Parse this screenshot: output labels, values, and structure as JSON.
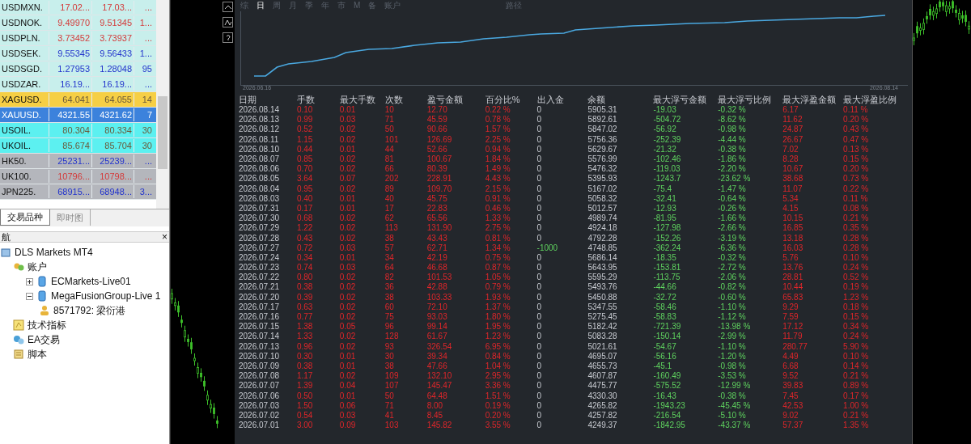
{
  "market_watch": {
    "rows": [
      {
        "symbol": "USDMXN.",
        "bid": "17.02...",
        "ask": "17.03...",
        "spread": "...",
        "kind": "down",
        "color": "#c8efec",
        "selected": false
      },
      {
        "symbol": "USDNOK.",
        "bid": "9.49970",
        "ask": "9.51345",
        "spread": "1...",
        "kind": "down",
        "color": "#c8efec",
        "selected": false
      },
      {
        "symbol": "USDPLN.",
        "bid": "3.73452",
        "ask": "3.73937",
        "spread": "...",
        "kind": "down",
        "color": "#c8efec",
        "selected": false
      },
      {
        "symbol": "USDSEK.",
        "bid": "9.55345",
        "ask": "9.56433",
        "spread": "1...",
        "kind": "up",
        "color": "#c8efec",
        "selected": false
      },
      {
        "symbol": "USDSGD.",
        "bid": "1.27953",
        "ask": "1.28048",
        "spread": "95",
        "kind": "up",
        "color": "#c8efec",
        "selected": false
      },
      {
        "symbol": "USDZAR.",
        "bid": "16.19...",
        "ask": "16.19...",
        "spread": "...",
        "kind": "up",
        "color": "#c8efec",
        "selected": false
      },
      {
        "symbol": "XAGUSD.",
        "bid": "64.041",
        "ask": "64.055",
        "spread": "14",
        "kind": "flat",
        "color": "#f6cf45",
        "selected": false
      },
      {
        "symbol": "XAUUSD.",
        "bid": "4321.55",
        "ask": "4321.62",
        "spread": "7",
        "color": "#3c82dc",
        "selected": true
      },
      {
        "symbol": "USOIL.",
        "bid": "80.304",
        "ask": "80.334",
        "spread": "30",
        "kind": "flat",
        "color": "#5cf0f0",
        "selected": false
      },
      {
        "symbol": "UKOIL.",
        "bid": "85.674",
        "ask": "85.704",
        "spread": "30",
        "kind": "flat",
        "color": "#5cf0f0",
        "selected": false
      },
      {
        "symbol": "HK50.",
        "bid": "25231...",
        "ask": "25239...",
        "spread": "...",
        "kind": "up",
        "color": "#b4b6bc",
        "selected": false
      },
      {
        "symbol": "UK100.",
        "bid": "10796...",
        "ask": "10798...",
        "spread": "...",
        "kind": "down",
        "color": "#b4b6bc",
        "selected": false
      },
      {
        "symbol": "JPN225.",
        "bid": "68915...",
        "ask": "68948...",
        "spread": "3...",
        "kind": "up",
        "color": "#b4b6bc",
        "selected": false
      }
    ]
  },
  "panel_tabs": [
    {
      "label": "交易品种",
      "selected": true
    },
    {
      "label": "即时图",
      "selected": false
    }
  ],
  "navigator": {
    "title": "航",
    "close": "×",
    "tree": [
      {
        "label": "DLS Markets MT4",
        "kind": "terminal",
        "children": [
          {
            "label": "账户",
            "kind": "accounts",
            "children": [
              {
                "label": "ECMarkets-Live01",
                "kind": "server",
                "expanded": false
              },
              {
                "label": "MegaFusionGroup-Live 1",
                "kind": "server",
                "expanded": true,
                "children": [
                  {
                    "label": "8571792: 梁衍港",
                    "kind": "user"
                  }
                ]
              }
            ]
          },
          {
            "label": "技术指标",
            "kind": "indicator"
          },
          {
            "label": "EA交易",
            "kind": "expert"
          },
          {
            "label": "脚本",
            "kind": "script"
          }
        ]
      }
    ]
  },
  "report": {
    "period_tabs": [
      {
        "label": "综",
        "selected": false
      },
      {
        "label": "日",
        "selected": true
      },
      {
        "label": "周",
        "selected": false
      },
      {
        "label": "月",
        "selected": false
      },
      {
        "label": "季",
        "selected": false
      },
      {
        "label": "年",
        "selected": false
      },
      {
        "label": "市",
        "selected": false
      },
      {
        "label": "M",
        "selected": false
      },
      {
        "label": "备",
        "selected": false
      },
      {
        "label": "账户",
        "selected": false
      }
    ],
    "path_label": "路径",
    "equity_chart": {
      "start_label": "2026.06.16",
      "end_label": "2026.08.14"
    },
    "table": {
      "columns": [
        {
          "label": "日期",
          "kind": "neutral"
        },
        {
          "label": "手数",
          "kind": "loss"
        },
        {
          "label": "最大手数",
          "kind": "loss"
        },
        {
          "label": "次数",
          "kind": "loss"
        },
        {
          "label": "盈亏金额",
          "kind": "loss"
        },
        {
          "label": "百分比%",
          "kind": "loss"
        },
        {
          "label": "出入金",
          "kind": "flow"
        },
        {
          "label": "余额",
          "kind": "neutral"
        },
        {
          "label": "最大浮亏金额",
          "kind": "profit"
        },
        {
          "label": "最大浮亏比例",
          "kind": "profit"
        },
        {
          "label": "最大浮盈金额",
          "kind": "loss"
        },
        {
          "label": "最大浮盈比例",
          "kind": "loss"
        }
      ],
      "rows": [
        {
          "withdrawal": false,
          "cells": [
            "2026.08.14",
            "0.10",
            "0.01",
            "10",
            "12.70",
            "0.22 %",
            "0",
            "5905.31",
            "-19.03",
            "-0.32 %",
            "6.17",
            "0.11 %"
          ]
        },
        {
          "withdrawal": false,
          "cells": [
            "2026.08.13",
            "0.99",
            "0.03",
            "71",
            "45.59",
            "0.78 %",
            "0",
            "5892.61",
            "-504.72",
            "-8.62 %",
            "11.62",
            "0.20 %"
          ]
        },
        {
          "withdrawal": false,
          "cells": [
            "2026.08.12",
            "0.52",
            "0.02",
            "50",
            "90.66",
            "1.57 %",
            "0",
            "5847.02",
            "-56.92",
            "-0.98 %",
            "24.87",
            "0.43 %"
          ]
        },
        {
          "withdrawal": false,
          "cells": [
            "2026.08.11",
            "1.15",
            "0.02",
            "101",
            "126.69",
            "2.25 %",
            "0",
            "5756.36",
            "-252.39",
            "-4.44 %",
            "26.67",
            "0.47 %"
          ]
        },
        {
          "withdrawal": false,
          "cells": [
            "2026.08.10",
            "0.44",
            "0.01",
            "44",
            "52.66",
            "0.94 %",
            "0",
            "5629.67",
            "-21.32",
            "-0.38 %",
            "7.02",
            "0.13 %"
          ]
        },
        {
          "withdrawal": false,
          "cells": [
            "2026.08.07",
            "0.85",
            "0.02",
            "81",
            "100.67",
            "1.84 %",
            "0",
            "5576.99",
            "-102.46",
            "-1.86 %",
            "8.28",
            "0.15 %"
          ]
        },
        {
          "withdrawal": false,
          "cells": [
            "2026.08.06",
            "0.70",
            "0.02",
            "66",
            "80.39",
            "1.49 %",
            "0",
            "5476.32",
            "-119.03",
            "-2.20 %",
            "10.67",
            "0.20 %"
          ]
        },
        {
          "withdrawal": false,
          "cells": [
            "2026.08.05",
            "3.64",
            "0.07",
            "202",
            "228.91",
            "4.43 %",
            "0",
            "5395.93",
            "-1243.7",
            "-23.62 %",
            "38.68",
            "0.73 %"
          ]
        },
        {
          "withdrawal": false,
          "cells": [
            "2026.08.04",
            "0.95",
            "0.02",
            "89",
            "109.70",
            "2.15 %",
            "0",
            "5167.02",
            "-75.4",
            "-1.47 %",
            "11.07",
            "0.22 %"
          ]
        },
        {
          "withdrawal": false,
          "cells": [
            "2026.08.03",
            "0.40",
            "0.01",
            "40",
            "45.75",
            "0.91 %",
            "0",
            "5058.32",
            "-32.41",
            "-0.64 %",
            "5.34",
            "0.11 %"
          ]
        },
        {
          "withdrawal": false,
          "cells": [
            "2026.07.31",
            "0.17",
            "0.01",
            "17",
            "22.83",
            "0.46 %",
            "0",
            "5012.57",
            "-12.93",
            "-0.26 %",
            "4.15",
            "0.08 %"
          ]
        },
        {
          "withdrawal": false,
          "cells": [
            "2026.07.30",
            "0.68",
            "0.02",
            "62",
            "65.56",
            "1.33 %",
            "0",
            "4989.74",
            "-81.95",
            "-1.66 %",
            "10.15",
            "0.21 %"
          ]
        },
        {
          "withdrawal": false,
          "cells": [
            "2026.07.29",
            "1.22",
            "0.02",
            "113",
            "131.90",
            "2.75 %",
            "0",
            "4924.18",
            "-127.98",
            "-2.66 %",
            "16.85",
            "0.35 %"
          ]
        },
        {
          "withdrawal": false,
          "cells": [
            "2026.07.28",
            "0.43",
            "0.02",
            "38",
            "43.43",
            "0.81 %",
            "0",
            "4792.28",
            "-152.26",
            "-3.19 %",
            "13.18",
            "0.28 %"
          ]
        },
        {
          "withdrawal": true,
          "cells": [
            "2026.07.27",
            "0.72",
            "0.03",
            "57",
            "62.71",
            "1.34 %",
            "-1000",
            "4748.85",
            "-362.24",
            "-6.36 %",
            "16.03",
            "0.28 %"
          ]
        },
        {
          "withdrawal": false,
          "cells": [
            "2026.07.24",
            "0.34",
            "0.01",
            "34",
            "42.19",
            "0.75 %",
            "0",
            "5686.14",
            "-18.35",
            "-0.32 %",
            "5.76",
            "0.10 %"
          ]
        },
        {
          "withdrawal": false,
          "cells": [
            "2026.07.23",
            "0.74",
            "0.03",
            "64",
            "46.68",
            "0.87 %",
            "0",
            "5643.95",
            "-153.81",
            "-2.72 %",
            "13.76",
            "0.24 %"
          ]
        },
        {
          "withdrawal": false,
          "cells": [
            "2026.07.22",
            "0.80",
            "0.02",
            "82",
            "101.53",
            "1.05 %",
            "0",
            "5595.29",
            "-113.75",
            "-2.06 %",
            "28.81",
            "0.52 %"
          ]
        },
        {
          "withdrawal": false,
          "cells": [
            "2026.07.21",
            "0.38",
            "0.02",
            "36",
            "42.88",
            "0.79 %",
            "0",
            "5493.76",
            "-44.66",
            "-0.82 %",
            "10.44",
            "0.19 %"
          ]
        },
        {
          "withdrawal": false,
          "cells": [
            "2026.07.20",
            "0.39",
            "0.02",
            "38",
            "103.33",
            "1.93 %",
            "0",
            "5450.88",
            "-32.72",
            "-0.60 %",
            "65.83",
            "1.23 %"
          ]
        },
        {
          "withdrawal": false,
          "cells": [
            "2026.07.17",
            "0.63",
            "0.02",
            "60",
            "72.10",
            "1.37 %",
            "0",
            "5347.55",
            "-58.46",
            "-1.10 %",
            "9.29",
            "0.18 %"
          ]
        },
        {
          "withdrawal": false,
          "cells": [
            "2026.07.16",
            "0.77",
            "0.02",
            "75",
            "93.03",
            "1.80 %",
            "0",
            "5275.45",
            "-58.83",
            "-1.12 %",
            "7.59",
            "0.15 %"
          ]
        },
        {
          "withdrawal": false,
          "cells": [
            "2026.07.15",
            "1.38",
            "0.05",
            "96",
            "99.14",
            "1.95 %",
            "0",
            "5182.42",
            "-721.39",
            "-13.98 %",
            "17.12",
            "0.34 %"
          ]
        },
        {
          "withdrawal": false,
          "cells": [
            "2026.07.14",
            "1.33",
            "0.02",
            "128",
            "61.67",
            "1.23 %",
            "0",
            "5083.28",
            "-150.14",
            "-2.99 %",
            "11.79",
            "0.24 %"
          ]
        },
        {
          "withdrawal": false,
          "cells": [
            "2026.07.13",
            "0.96",
            "0.02",
            "93",
            "326.54",
            "6.95 %",
            "0",
            "5021.61",
            "-54.67",
            "-1.10 %",
            "280.77",
            "5.90 %"
          ]
        },
        {
          "withdrawal": false,
          "cells": [
            "2026.07.10",
            "0.30",
            "0.01",
            "30",
            "39.34",
            "0.84 %",
            "0",
            "4695.07",
            "-56.16",
            "-1.20 %",
            "4.49",
            "0.10 %"
          ]
        },
        {
          "withdrawal": false,
          "cells": [
            "2026.07.09",
            "0.38",
            "0.01",
            "38",
            "47.66",
            "1.04 %",
            "0",
            "4655.73",
            "-45.1",
            "-0.98 %",
            "6.68",
            "0.14 %"
          ]
        },
        {
          "withdrawal": false,
          "cells": [
            "2026.07.08",
            "1.17",
            "0.02",
            "109",
            "132.10",
            "2.95 %",
            "0",
            "4607.87",
            "-160.49",
            "-3.53 %",
            "9.52",
            "0.21 %"
          ]
        },
        {
          "withdrawal": false,
          "cells": [
            "2026.07.07",
            "1.39",
            "0.04",
            "107",
            "145.47",
            "3.36 %",
            "0",
            "4475.77",
            "-575.52",
            "-12.99 %",
            "39.83",
            "0.89 %"
          ]
        },
        {
          "withdrawal": false,
          "cells": [
            "2026.07.06",
            "0.50",
            "0.01",
            "50",
            "64.48",
            "1.51 %",
            "0",
            "4330.30",
            "-16.43",
            "-0.38 %",
            "7.45",
            "0.17 %"
          ]
        },
        {
          "withdrawal": false,
          "cells": [
            "2026.07.03",
            "1.50",
            "0.06",
            "71",
            "8.00",
            "0.19 %",
            "0",
            "4265.82",
            "-1943.23",
            "-45.45 %",
            "42.53",
            "1.00 %"
          ]
        },
        {
          "withdrawal": false,
          "cells": [
            "2026.07.02",
            "0.54",
            "0.03",
            "41",
            "8.45",
            "0.20 %",
            "0",
            "4257.82",
            "-216.54",
            "-5.10 %",
            "9.02",
            "0.21 %"
          ]
        },
        {
          "withdrawal": false,
          "cells": [
            "2026.07.01",
            "3.00",
            "0.09",
            "103",
            "145.82",
            "3.55 %",
            "0",
            "4249.37",
            "-1842.95",
            "-43.37 %",
            "57.37",
            "1.35 %"
          ]
        }
      ]
    }
  }
}
